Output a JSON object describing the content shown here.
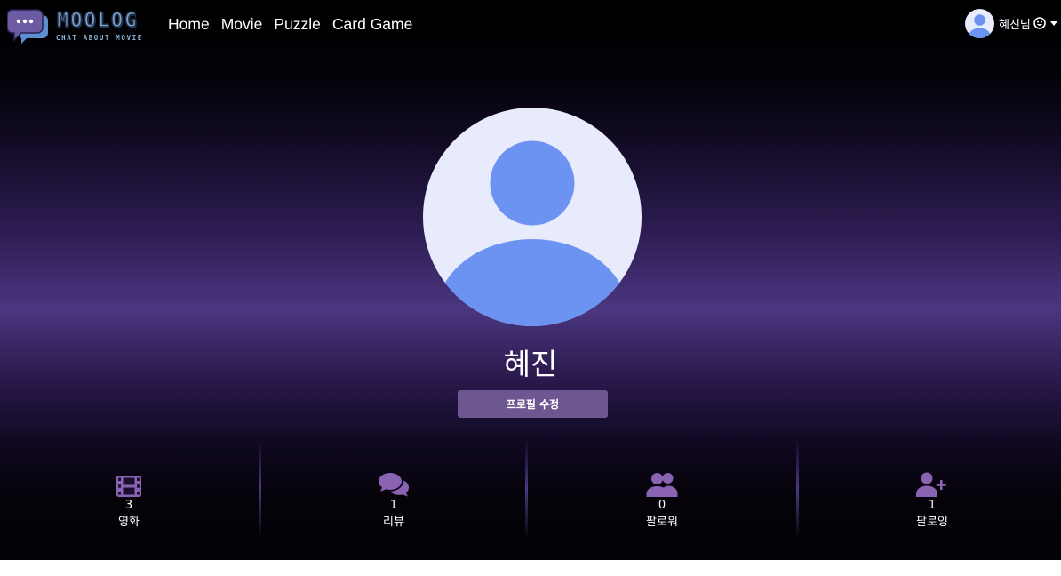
{
  "nav": {
    "logo": {
      "title": "MOOLOG",
      "subtitle": "CHAT ABOUT MOVIE"
    },
    "links": [
      "Home",
      "Movie",
      "Puzzle",
      "Card Game"
    ],
    "user": {
      "name": "혜진님",
      "avatar_icon": "user-avatar-icon",
      "emoji_icon": "smile-face-icon"
    }
  },
  "profile": {
    "name": "혜진",
    "edit_label": "프로필 수정",
    "avatar_icon": "default-user-avatar"
  },
  "stats": [
    {
      "icon": "film-icon",
      "count": "3",
      "label": "영화"
    },
    {
      "icon": "comments-icon",
      "count": "1",
      "label": "리뷰"
    },
    {
      "icon": "users-icon",
      "count": "0",
      "label": "팔로워"
    },
    {
      "icon": "user-plus-icon",
      "count": "1",
      "label": "팔로잉"
    }
  ],
  "colors": {
    "accent": "#6d5791",
    "icon": "#8a63b3",
    "avatar_bg": "#e8ebfb",
    "avatar_fg": "#6d93f2",
    "band": "#4b3680"
  }
}
